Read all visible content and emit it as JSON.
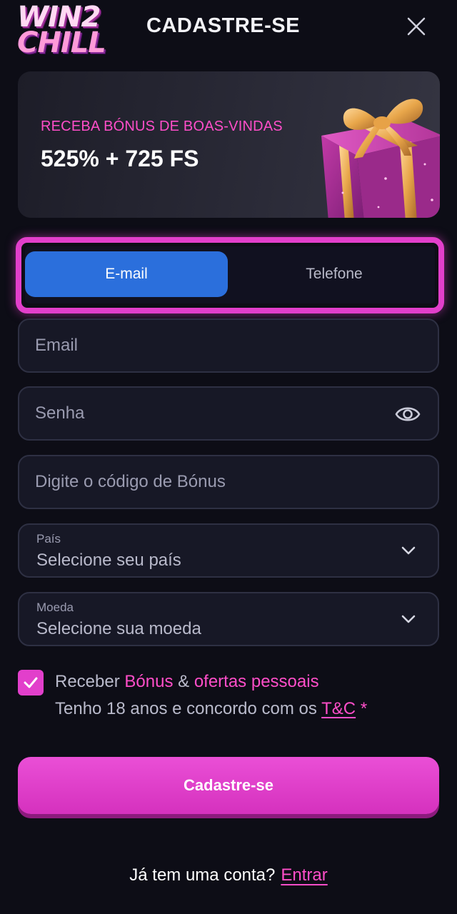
{
  "header": {
    "logo_line1": "WIN2",
    "logo_line2": "CHILL",
    "title": "CADASTRE-SE"
  },
  "banner": {
    "subtitle": "RECEBA BÓNUS DE BOAS-VINDAS",
    "headline": "525% + 725 FS"
  },
  "tabs": {
    "email_label": "E-mail",
    "phone_label": "Telefone",
    "active": "E-mail"
  },
  "form": {
    "email_placeholder": "Email",
    "password_placeholder": "Senha",
    "bonus_placeholder": "Digite o código de Bónus",
    "country_label": "País",
    "country_value": "Selecione seu país",
    "currency_label": "Moeda",
    "currency_value": "Selecione sua moeda"
  },
  "consent": {
    "checked": true,
    "receive": "Receber",
    "bonus": "Bónus",
    "amp": "&",
    "offers": "ofertas pessoais",
    "age_text": "Tenho 18 anos e concordo com os",
    "tc": "T&C",
    "asterisk": "*"
  },
  "submit_label": "Cadastre-se",
  "footer": {
    "question": "Já tem uma conta?",
    "login": "Entrar"
  },
  "colors": {
    "accent_pink": "#e23fcb",
    "tab_active_blue": "#2b6fdc",
    "background": "#0d0d16"
  }
}
